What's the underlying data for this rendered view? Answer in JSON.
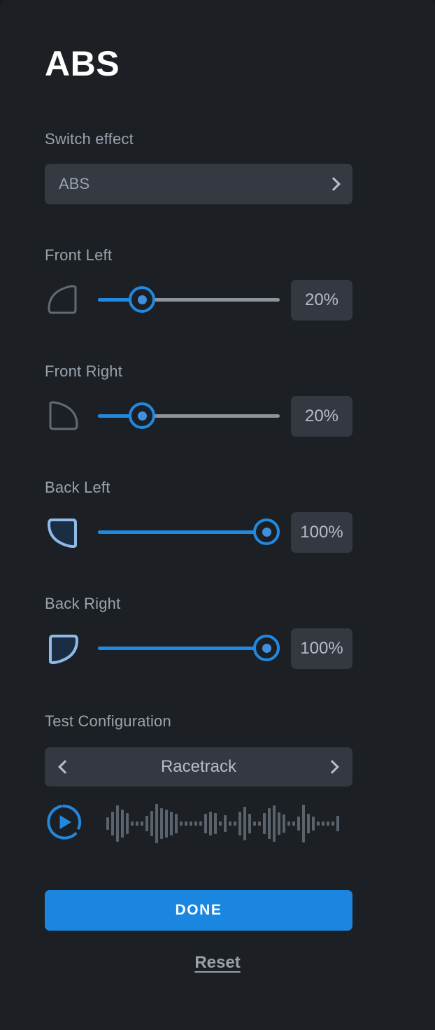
{
  "title": "ABS",
  "switch_effect": {
    "label": "Switch effect",
    "value": "ABS",
    "chevron": "chevron-right-icon"
  },
  "wheels": [
    {
      "key": "front_left",
      "label": "Front Left",
      "value": 20,
      "display": "20%",
      "icon": "wheel-front-left-icon",
      "active": false
    },
    {
      "key": "front_right",
      "label": "Front Right",
      "value": 20,
      "display": "20%",
      "icon": "wheel-front-right-icon",
      "active": false
    },
    {
      "key": "back_left",
      "label": "Back Left",
      "value": 100,
      "display": "100%",
      "icon": "wheel-back-left-icon",
      "active": true
    },
    {
      "key": "back_right",
      "label": "Back Right",
      "value": 100,
      "display": "100%",
      "icon": "wheel-back-right-icon",
      "active": true
    }
  ],
  "test_configuration": {
    "label": "Test Configuration",
    "value": "Racetrack",
    "prev_icon": "chevron-left-icon",
    "next_icon": "chevron-right-icon"
  },
  "player": {
    "play_icon": "play-circle-icon",
    "waveform_name": "audio-waveform",
    "waveform": [
      18,
      34,
      52,
      40,
      30,
      6,
      6,
      6,
      22,
      36,
      56,
      44,
      40,
      34,
      28,
      6,
      6,
      6,
      6,
      6,
      28,
      34,
      30,
      6,
      24,
      6,
      6,
      34,
      48,
      28,
      6,
      6,
      30,
      44,
      52,
      32,
      26,
      6,
      6,
      20,
      54,
      28,
      20,
      6,
      6,
      6,
      6,
      22
    ]
  },
  "actions": {
    "done": "DONE",
    "reset": "Reset"
  },
  "colors": {
    "accent": "#1a86e0",
    "slider_fill": "#2289e0",
    "panel_bg": "#1c2025",
    "field_bg": "#333841",
    "text_muted": "#9aa3ad",
    "wheel_inactive": "#626a74",
    "wheel_active_fill": "#1b2d42",
    "wheel_active_stroke": "#8fb9e6"
  }
}
